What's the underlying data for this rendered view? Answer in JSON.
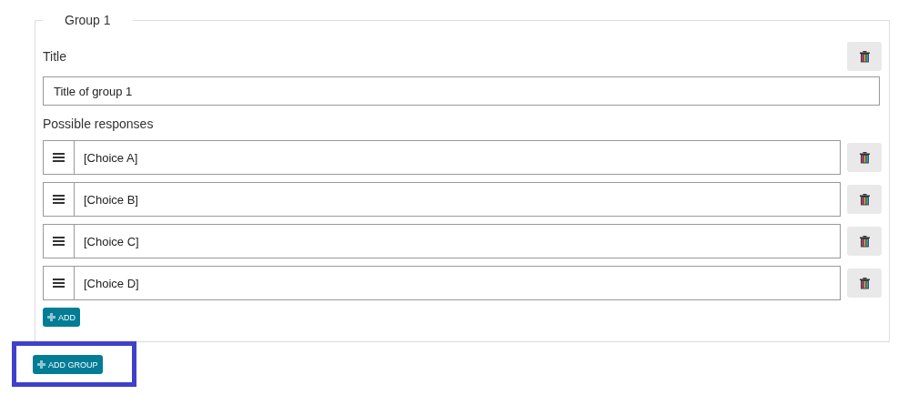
{
  "group": {
    "legend": "Group 1",
    "title_label": "Title",
    "title_value": "Title of group 1",
    "responses_label": "Possible responses",
    "responses": [
      {
        "value": "[Choice A]"
      },
      {
        "value": "[Choice B]"
      },
      {
        "value": "[Choice C]"
      },
      {
        "value": "[Choice D]"
      }
    ],
    "add_button": "ADD"
  },
  "add_group_button": {
    "label": "ADD GROUP",
    "highlighted": true
  }
}
